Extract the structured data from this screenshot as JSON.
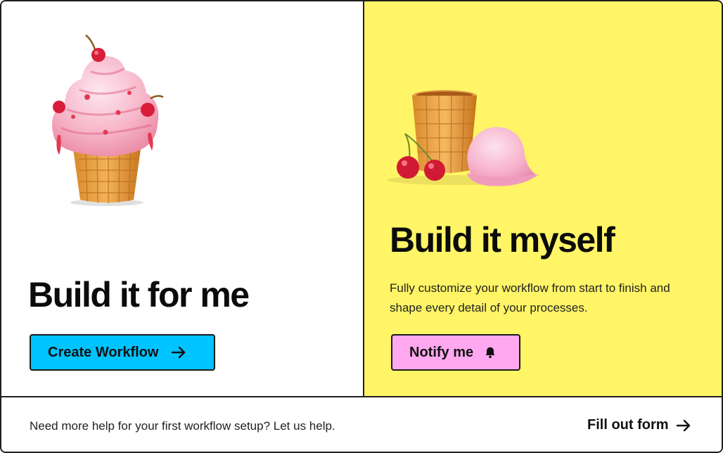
{
  "left_option": {
    "heading": "Build it for me",
    "button_label": "Create Workflow",
    "button_color": "#00c4ff",
    "illustration": "ice-cream-cone-with-cherries"
  },
  "right_option": {
    "heading": "Build it myself",
    "description": "Fully customize your workflow from start to finish and shape every detail of your processes.",
    "button_label": "Notify me",
    "button_color": "#ffa8f0",
    "panel_color": "#fff566",
    "illustration": "waffle-cone-scoop-and-cherries"
  },
  "footer": {
    "help_text": "Need more help for your first workflow setup? Let us help.",
    "link_label": "Fill out form"
  },
  "icons": {
    "arrow": "arrow-right-icon",
    "bell": "bell-icon"
  }
}
